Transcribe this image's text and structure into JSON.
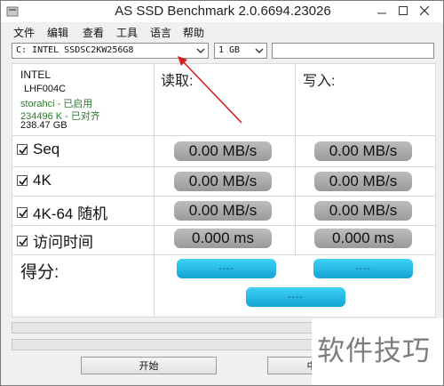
{
  "window": {
    "title": "AS SSD Benchmark 2.0.6694.23026"
  },
  "menu": {
    "items": [
      "文件",
      "编辑",
      "查看",
      "工具",
      "语言",
      "帮助"
    ]
  },
  "toolbar": {
    "drive_select": "C: INTEL SSDSC2KW256G8",
    "size_select": "1 GB",
    "extra_field": ""
  },
  "drive_info": {
    "vendor": "INTEL",
    "firmware": "LHF004C",
    "driver": "storahci - 已启用",
    "alignment": "234496 K - 已对齐",
    "capacity": "238.47 GB"
  },
  "columns": {
    "read": "读取:",
    "write": "写入:"
  },
  "tests": [
    {
      "label": "Seq",
      "read": "0.00 MB/s",
      "write": "0.00 MB/s"
    },
    {
      "label": "4K",
      "read": "0.00 MB/s",
      "write": "0.00 MB/s"
    },
    {
      "label": "4K-64 随机",
      "read": "0.00 MB/s",
      "write": "0.00 MB/s"
    },
    {
      "label": "访问时间",
      "read": "0.000 ms",
      "write": "0.000 ms"
    }
  ],
  "score": {
    "label": "得分:",
    "read": "----",
    "write": "----",
    "total": "----"
  },
  "buttons": {
    "start": "开始",
    "abort": "中"
  },
  "watermark": "软件技巧"
}
